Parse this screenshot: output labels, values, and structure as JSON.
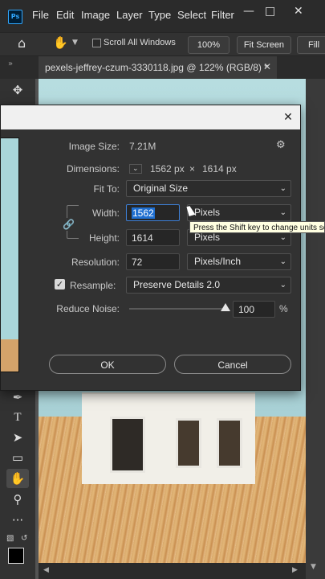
{
  "app": {
    "logo": "Ps",
    "menu": [
      "File",
      "Edit",
      "Image",
      "Layer",
      "Type",
      "Select",
      "Filter"
    ]
  },
  "options_bar": {
    "scroll_all_windows": "Scroll All Windows",
    "zoom": "100%",
    "fit_screen": "Fit Screen",
    "fill": "Fill"
  },
  "document": {
    "tab_title": "pexels-jeffrey-czum-3330118.jpg @ 122% (RGB/8) *"
  },
  "image_size_dialog": {
    "image_size_label": "Image Size:",
    "image_size_value": "7.21M",
    "dimensions_label": "Dimensions:",
    "dim_width": "1562 px",
    "dim_times": "×",
    "dim_height": "1614 px",
    "fit_to_label": "Fit To:",
    "fit_to_value": "Original Size",
    "width_label": "Width:",
    "width_value": "1562",
    "width_unit": "Pixels",
    "height_label": "Height:",
    "height_value": "1614",
    "height_unit": "Pixels",
    "resolution_label": "Resolution:",
    "resolution_value": "72",
    "resolution_unit": "Pixels/Inch",
    "resample_label": "Resample:",
    "resample_checked": true,
    "resample_value": "Preserve Details 2.0",
    "reduce_noise_label": "Reduce Noise:",
    "reduce_noise_value": "100",
    "reduce_noise_fraction": 1.0,
    "percent_sign": "%",
    "ok_label": "OK",
    "cancel_label": "Cancel",
    "tooltip": "Press the Shift key to change units sep"
  },
  "colors": {
    "accent": "#31a8ff",
    "selection": "#1f6fd1",
    "tooltip_bg": "#ffffe1"
  }
}
